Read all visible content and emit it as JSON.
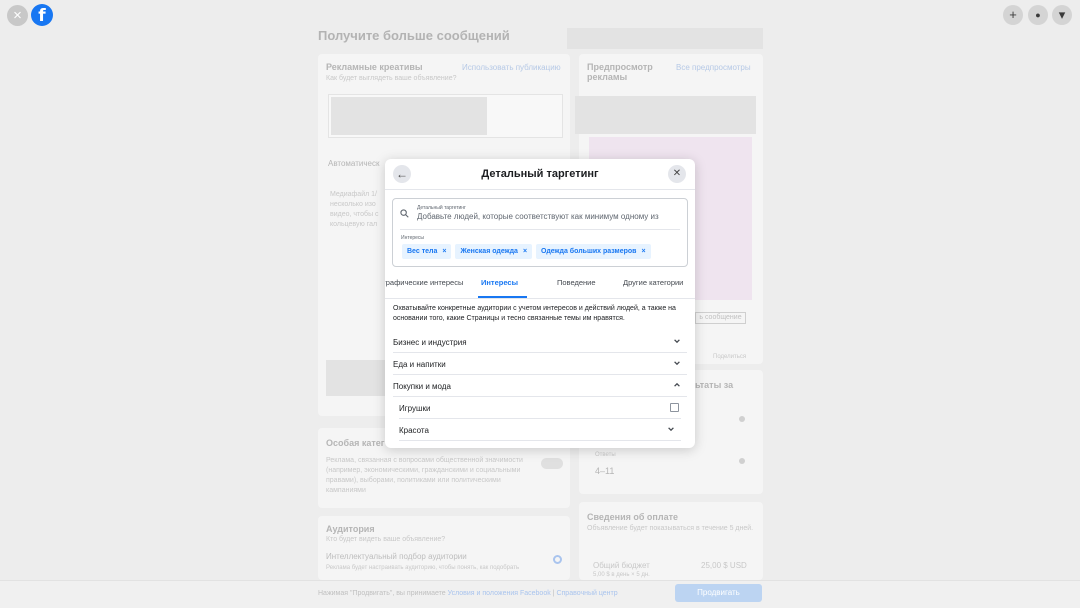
{
  "topbar": {
    "close_icon": "×",
    "logo": "f",
    "icons": [
      "plus-icon",
      "bell-icon",
      "caret-down-icon"
    ],
    "plus": "+",
    "bell": "●",
    "caret": "▾"
  },
  "background": {
    "page_title": "Получите больше сообщений",
    "creatives_title": "Рекламные креативы",
    "creatives_sub": "Как будет выглядеть ваше объявление?",
    "use_post": "Использовать публикацию",
    "automatic": "Автоматическ",
    "media_text": [
      "Медиафайл 1/",
      "несколько изо",
      "видео, чтобы с",
      "кольцевую гал"
    ],
    "preview_title": "Предпросмотр рекламы",
    "all_previews": "Все предпросмотры",
    "send_message": "ь сообщение",
    "share": "Поделиться",
    "results": "ьтаты за",
    "answers_label": "Ответы",
    "answers_value": "4–11",
    "special_title": "Особая катег",
    "special_text": "Реклама, связанная с вопросами общественной значимости (например, экономическими, гражданскими и социальными правами), выборами, политиками или политическими кампаниями",
    "audience_title": "Аудитория",
    "audience_sub": "Кто будет видеть ваше объявление?",
    "smart_audience": "Интеллектуальный подбор аудитории",
    "smart_audience_sub": "Реклама будет настраивать аудиторию, чтобы понять, как подобрать больше людей, которые могут интересоваться вашей компанией.",
    "payment_title": "Сведения об оплате",
    "payment_sub": "Объявление будет показываться в течение 5 дней.",
    "budget_label": "Общий бюджет",
    "budget_value": "25,00 $ USD",
    "budget_sub": "5,00 $ в день × 5 дн.",
    "footer_prefix": "Нажимая \"Продвигать\", вы принимаете",
    "footer_link1": "Условия и положения Facebook",
    "footer_sep": "|",
    "footer_link2": "Справочный центр",
    "promote_button": "Продвигать"
  },
  "modal": {
    "back_icon": "←",
    "close_icon": "✕",
    "title": "Детальный таргетинг",
    "search_label": "Детальный таргетинг",
    "search_placeholder": "Добавьте людей, которые соответствуют как минимум одному из",
    "interests_label": "Интересы",
    "chips": [
      {
        "label": "Вес тела",
        "remove": "×"
      },
      {
        "label": "Женская одежда",
        "remove": "×"
      },
      {
        "label": "Одежда больших размеров",
        "remove": "×"
      }
    ],
    "tabs": [
      "графические интересы",
      "Интересы",
      "Поведение",
      "Другие категории"
    ],
    "active_tab": "Интересы",
    "description": "Охватывайте конкретные аудитории с учетом интересов и действий людей, а также на основании того, какие Страницы и тесно связанные темы им нравятся.",
    "categories": [
      {
        "label": "Бизнес и индустрия",
        "expanded": false
      },
      {
        "label": "Еда и напитки",
        "expanded": false
      },
      {
        "label": "Покупки и мода",
        "expanded": true
      }
    ],
    "subcategories": [
      {
        "label": "Игрушки",
        "checked": false
      },
      {
        "label": "Красота",
        "expandable": true
      }
    ]
  },
  "colors": {
    "accent": "#1877f2",
    "chip_bg": "#e7f3ff",
    "divider": "#e4e6eb"
  }
}
